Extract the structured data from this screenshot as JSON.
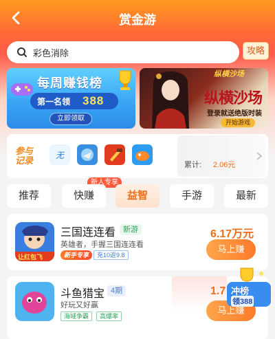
{
  "header": {
    "title": "赏金游",
    "search_text": "彩色消除",
    "guide_label": "攻略"
  },
  "banners": {
    "weekly": {
      "title": "每周赚钱榜",
      "rank_label": "第一名领",
      "rank_amount": "388",
      "claim_label": "立即领取"
    },
    "game_ad": {
      "logo_text": "纵横沙场",
      "slogan": "纵横沙场",
      "subtitle": "登录就送绝版时装",
      "play_label": "开始游戏"
    }
  },
  "record": {
    "label": "参与记录",
    "accumulated_label": "累计:",
    "accumulated_value": "2.06元",
    "icons": [
      "app-icon-1",
      "app-icon-2",
      "app-icon-3",
      "app-icon-4"
    ]
  },
  "tabs": {
    "items": [
      {
        "label": "推荐",
        "active": false
      },
      {
        "label": "快赚",
        "active": false
      },
      {
        "label": "益智",
        "active": true
      },
      {
        "label": "手游",
        "active": false
      },
      {
        "label": "最新",
        "active": false
      }
    ],
    "badge": "新人专享"
  },
  "games": [
    {
      "name": "三国连连看",
      "tag": "新游",
      "desc": "英雄者，手握三国连连看",
      "chip_new": "新手专享",
      "chip_extra": "充10返9.8",
      "icon_text": "让红包飞",
      "reward": "6.17万元",
      "button_label": "马上赚"
    },
    {
      "name": "斗鱼猎宝",
      "tag": "4期",
      "desc": "好玩又好赢",
      "chip_1": "海域争霸",
      "chip_2": "高爆率",
      "reward": "1.7",
      "button_label": "马上赚"
    }
  ],
  "floating_promo": {
    "line1": "冲榜",
    "line2": "领388"
  },
  "colors": {
    "accent_orange": "#f06d1a",
    "header_orange": "#ff7a2a",
    "tag_green": "#2aa55a",
    "tag_blue": "#4a7ddc"
  }
}
